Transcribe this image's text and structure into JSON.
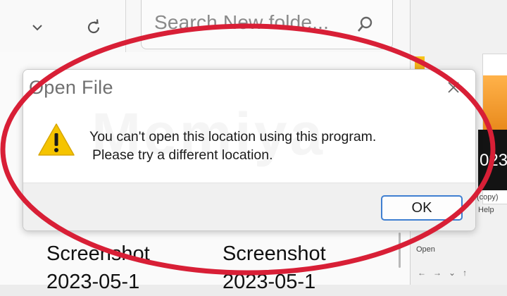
{
  "explorer": {
    "search_placeholder": "Search New folde...",
    "files": [
      {
        "line1": "Screenshot",
        "line2": "2023-05-1"
      },
      {
        "line1": "Screenshot",
        "line2": "2023-05-1"
      }
    ]
  },
  "side_panel": {
    "big_text": "023",
    "copy_label": "(copy)",
    "help_label": "Help",
    "open_label": "Open",
    "nav_glyphs": [
      "←",
      "→",
      "⌄",
      "↑"
    ]
  },
  "dialog": {
    "title": "Open File",
    "message_line1": "You can't open this location using this program.",
    "message_line2": "Please try a different location.",
    "ok_label": "OK",
    "icon": "warning-icon"
  },
  "watermark": "Memiya",
  "colors": {
    "annotation_red": "#d81f36",
    "ok_border": "#3f7fd1",
    "warning_yellow": "#f5c400"
  }
}
